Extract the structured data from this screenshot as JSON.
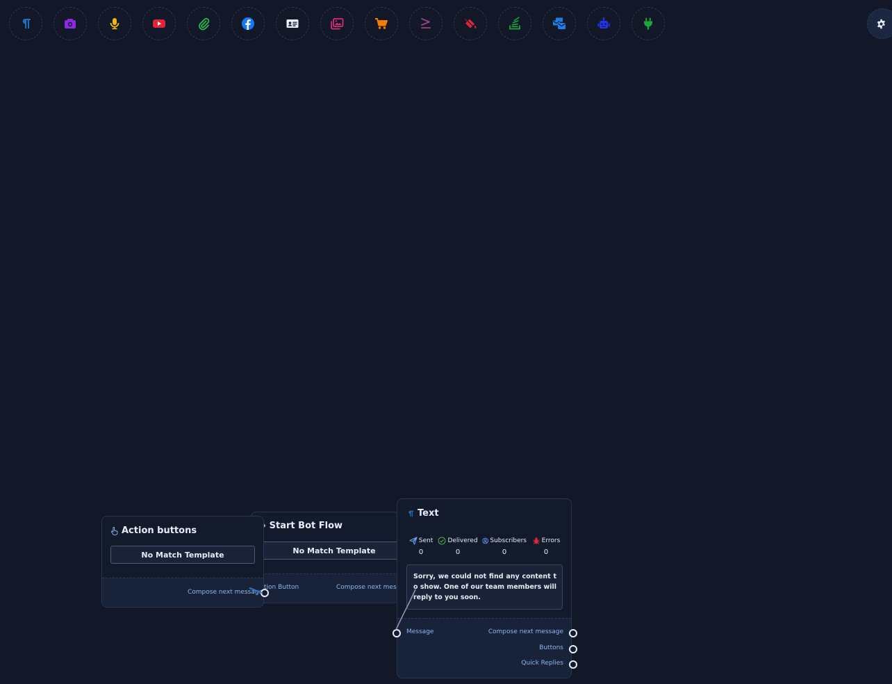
{
  "toolbar": {
    "tools": [
      {
        "icon": "paragraph-icon",
        "color": "#1e6fc0"
      },
      {
        "icon": "camera-icon",
        "color": "#8a2be2"
      },
      {
        "icon": "microphone-icon",
        "color": "#f5b800"
      },
      {
        "icon": "youtube-icon",
        "color": "#e0243a"
      },
      {
        "icon": "paperclip-icon",
        "color": "#2db34a"
      },
      {
        "icon": "facebook-icon",
        "color": "#1877f2"
      },
      {
        "icon": "contact-card-icon",
        "color": "#e8edf7"
      },
      {
        "icon": "images-icon",
        "color": "#e0297a"
      },
      {
        "icon": "shopping-cart-icon",
        "color": "#f57c00"
      },
      {
        "icon": "greater-equal-icon",
        "color": "#a0408a"
      },
      {
        "icon": "fill-bucket-icon",
        "color": "#e0243a"
      },
      {
        "icon": "stack-icon",
        "color": "#1aa83a"
      },
      {
        "icon": "mail-bulk-icon",
        "color": "#1e7ee6"
      },
      {
        "icon": "robot-icon",
        "color": "#2233ee"
      },
      {
        "icon": "plug-icon",
        "color": "#1aa83a"
      }
    ],
    "settings_icon": "gear-icon"
  },
  "nodes": {
    "action_buttons": {
      "title": "Action buttons",
      "template_label": "No Match Template",
      "output_label": "Compose next message"
    },
    "start_bot_flow": {
      "title": "Start Bot Flow",
      "template_label": "No Match Template",
      "input_label": "tion Button",
      "output_label": "Compose next messa"
    },
    "text": {
      "title": "Text",
      "stats": [
        {
          "label": "Sent",
          "value": "0",
          "icon": "paper-plane-icon",
          "color": "#6ea8fe"
        },
        {
          "label": "Delivered",
          "value": "0",
          "icon": "check-circle-icon",
          "color": "#4caf50"
        },
        {
          "label": "Subscribers",
          "value": "0",
          "icon": "user-circle-icon",
          "color": "#6ea8fe"
        },
        {
          "label": "Errors",
          "value": "0",
          "icon": "bug-icon",
          "color": "#e0243a"
        }
      ],
      "message": "Sorry, we could not find any content to show. One of our team members will reply to you soon.",
      "input_label": "Message",
      "outputs": [
        "Compose next message",
        "Buttons",
        "Quick Replies"
      ]
    }
  }
}
